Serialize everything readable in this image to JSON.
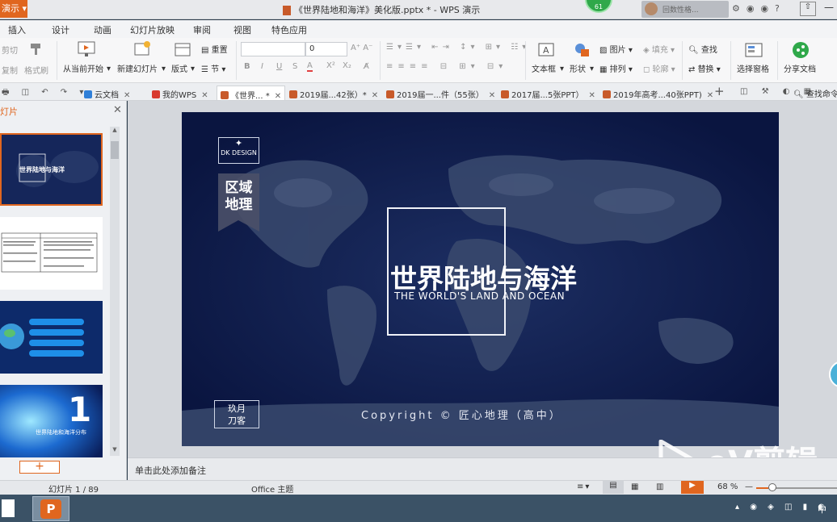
{
  "titlebar": {
    "app_menu": "演示",
    "title": "《世界陆地和海洋》美化版.pptx * - WPS 演示",
    "badge": "61",
    "user_name": "回数性格..."
  },
  "menu": [
    "插入",
    "设计",
    "动画",
    "幻灯片放映",
    "审阅",
    "视图",
    "特色应用"
  ],
  "ribbon": {
    "cut": "剪切",
    "copy": "复制",
    "format_painter": "格式刷",
    "from_current": "从当前开始",
    "new_slide": "新建幻灯片",
    "layout": "版式",
    "reset": "重置",
    "section": "节",
    "font_size": "0",
    "picture": "图片",
    "fill": "填充",
    "textbox": "文本框",
    "shape": "形状",
    "arrange": "排列",
    "outline": "轮廓",
    "find": "查找",
    "replace": "替换",
    "select_pane": "选择窗格",
    "share": "分享文档"
  },
  "tabs": [
    {
      "label": "云文档",
      "color": "#2f7fd8"
    },
    {
      "label": "我的WPS",
      "color": "#d83a2f"
    },
    {
      "label": "《世界... *",
      "color": "#c85a2a",
      "active": true
    },
    {
      "label": "2019届...42张）*",
      "color": "#c85a2a"
    },
    {
      "label": "2019届一...件（55张）",
      "color": "#c85a2a"
    },
    {
      "label": "2017届...5张PPT）",
      "color": "#c85a2a"
    },
    {
      "label": "2019年高考...40张PPT)",
      "color": "#c85a2a"
    }
  ],
  "tab_search": "查找命令",
  "left_panel": {
    "header": "灯片",
    "thumb1_title": "世界陆地与海洋",
    "thumb4_num": "1",
    "thumb4_caption": "世界陆地和海洋分布"
  },
  "slide": {
    "brand": "DK DESIGN",
    "ribbon_label": "区域\n地理",
    "title_cn": "世界陆地与海洋",
    "title_en": "THE WORLD'S LAND AND OCEAN",
    "author": "玖月\n刀客",
    "copyright": "Copyright © 匠心地理（高中）"
  },
  "notes_placeholder": "单击此处添加备注",
  "status": {
    "slide_counter": "幻灯片 1 / 89",
    "theme": "Office 主题",
    "zoom": "68 %",
    "zoom_value": 68
  },
  "watermark": "eV剪辑",
  "tray_ime": "中"
}
